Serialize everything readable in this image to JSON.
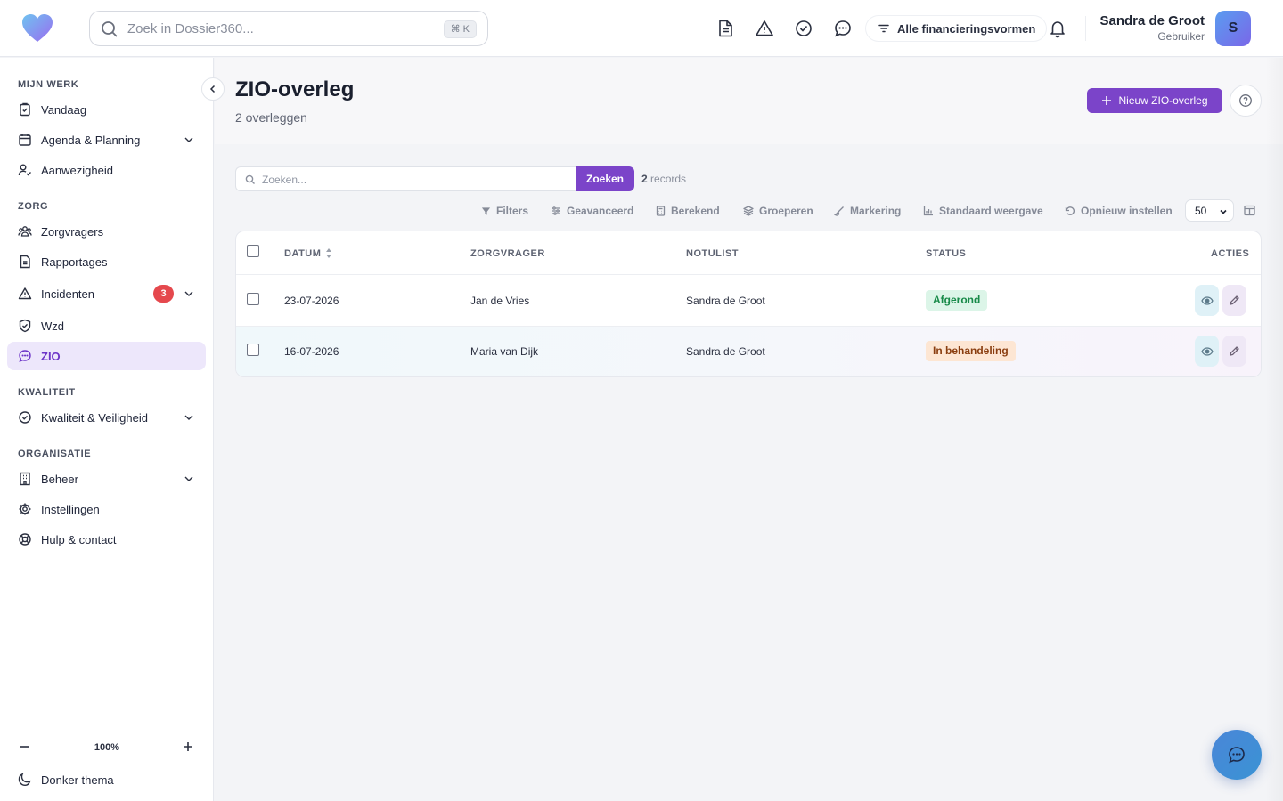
{
  "app": {
    "search_placeholder": "Zoek in Dossier360...",
    "search_shortcut": "⌘ K",
    "financing_filter": "Alle financieringsvormen",
    "brand_gradient": [
      "#6fc3f0",
      "#9a6cf0"
    ]
  },
  "user": {
    "name": "Sandra de Groot",
    "role": "Gebruiker",
    "initial": "S"
  },
  "sidebar": {
    "sections": {
      "mijn_werk": "MIJN WERK",
      "zorg": "ZORG",
      "kwaliteit": "KWALITEIT",
      "organisatie": "ORGANISATIE"
    },
    "items": {
      "vandaag": "Vandaag",
      "agenda": "Agenda & Planning",
      "aanwezigheid": "Aanwezigheid",
      "zorgvragers": "Zorgvragers",
      "rapportages": "Rapportages",
      "incidenten": "Incidenten",
      "incidenten_count": "3",
      "wzd": "Wzd",
      "zio": "ZIO",
      "kwaliteit": "Kwaliteit & Veiligheid",
      "beheer": "Beheer",
      "instellingen": "Instellingen",
      "hulp": "Hulp & contact"
    },
    "zoom_level": "100%",
    "dark_theme": "Donker thema"
  },
  "page": {
    "title": "ZIO-overleg",
    "subtitle": "2 overleggen",
    "new_button": "Nieuw ZIO-overleg"
  },
  "table_tools": {
    "search_placeholder": "Zoeken...",
    "search_button": "Zoeken",
    "record_count": "2",
    "record_label": "records",
    "filters": "Filters",
    "advanced": "Geavanceerd",
    "calculated": "Berekend",
    "group": "Groeperen",
    "highlight": "Markering",
    "default_view": "Standaard weergave",
    "reset": "Opnieuw instellen",
    "per_page": "50"
  },
  "table": {
    "columns": {
      "date": "DATUM",
      "client": "ZORGVRAGER",
      "note_taker": "NOTULIST",
      "status": "STATUS",
      "actions": "ACTIES"
    },
    "rows": [
      {
        "date": "23-07-2026",
        "client": "Jan de Vries",
        "note_taker": "Sandra de Groot",
        "status": "Afgerond"
      },
      {
        "date": "16-07-2026",
        "client": "Maria van Dijk",
        "note_taker": "Sandra de Groot",
        "status": "In behandeling"
      }
    ]
  },
  "colors": {
    "accent": "#7b44c9",
    "status_done_bg": "#dcf5e8",
    "status_done_text": "#178a48",
    "status_busy_bg": "#fde6d3",
    "status_busy_text": "#8a3e10",
    "badge": "#e5484d"
  }
}
